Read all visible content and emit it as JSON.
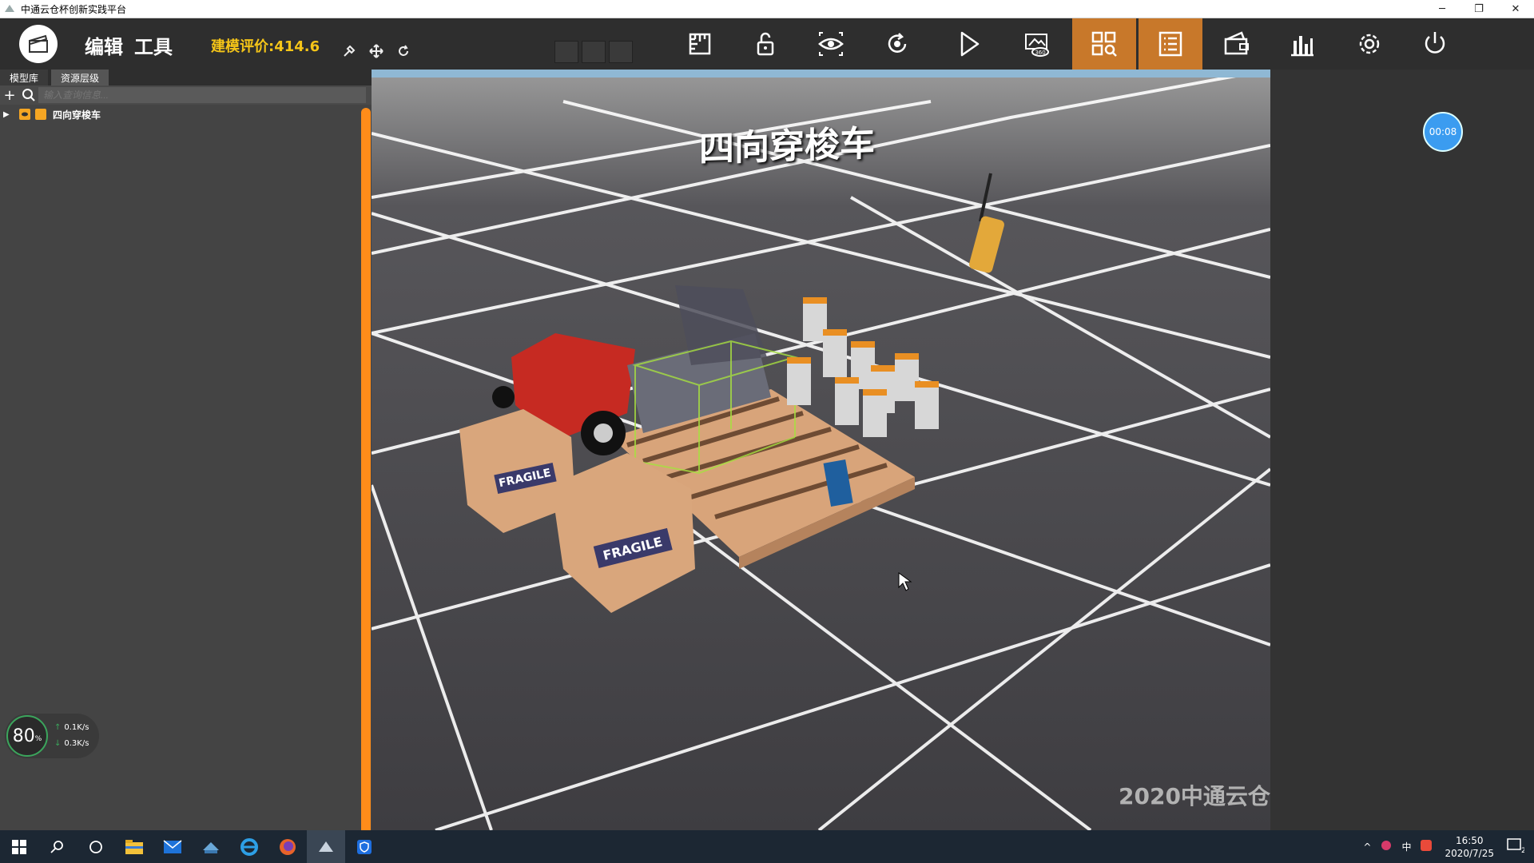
{
  "window": {
    "title": "中通云仓杯创新实践平台",
    "controls": [
      "─",
      "❐",
      "✕"
    ]
  },
  "toolbar": {
    "menu_edit": "编辑",
    "menu_tools": "工具",
    "score_text": "建模评价:414.6",
    "buttons": [
      "ruler-icon",
      "unlock-icon",
      "eye-icon",
      "rotate-icon",
      "play-icon",
      "360-view-icon",
      "grid-search-icon",
      "list-icon",
      "wallet-icon",
      "bar-chart-icon",
      "settings-icon",
      "power-icon"
    ],
    "active_buttons": [
      "grid-search-icon",
      "list-icon"
    ],
    "accent": "#c8782a"
  },
  "left_panel": {
    "tabs": [
      "模型库",
      "资源层级"
    ],
    "search_placeholder": "输入查询信息...",
    "tree": [
      {
        "label": "四向穿梭车",
        "expanded": false
      }
    ]
  },
  "viewport": {
    "scene_title": "四向穿梭车",
    "watermark": "2020中通云仓"
  },
  "perf": {
    "percent": "80",
    "unit": "%",
    "up_rate": "0.1K/s",
    "down_rate": "0.3K/s"
  },
  "timer": "00:08",
  "taskbar": {
    "ime": "中",
    "time": "16:50",
    "date": "2020/7/25",
    "notifications": "2"
  }
}
